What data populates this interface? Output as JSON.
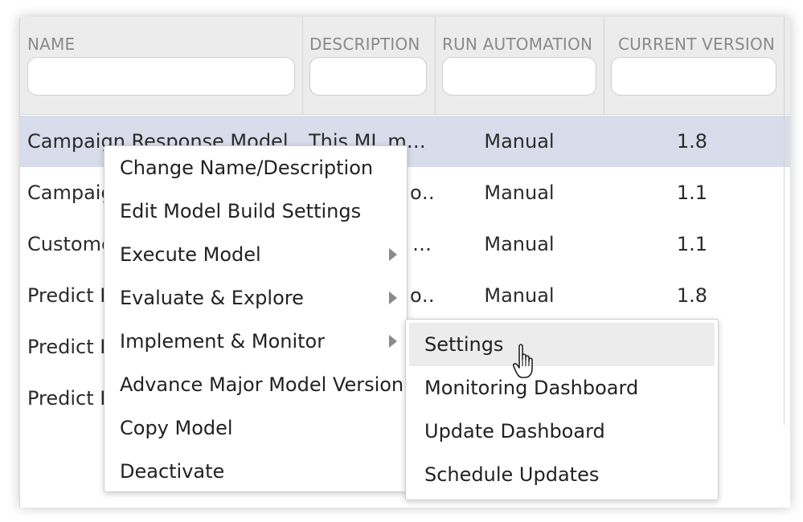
{
  "table": {
    "columns": [
      {
        "label": "NAME",
        "placeholder": ""
      },
      {
        "label": "DESCRIPTION",
        "placeholder": ""
      },
      {
        "label": "RUN AUTOMATION",
        "placeholder": ""
      },
      {
        "label": "CURRENT VERSION",
        "placeholder": ""
      }
    ],
    "rows": [
      {
        "name": "Campaign Response Model",
        "description": "This ML mo…",
        "run": "Manual",
        "version": "1.8"
      },
      {
        "name": "Campaign",
        "description": "o…",
        "run": "Manual",
        "version": "1.1"
      },
      {
        "name": "Custome",
        "description": "…",
        "run": "Manual",
        "version": "1.1"
      },
      {
        "name": "Predict F",
        "description": "o…",
        "run": "Manual",
        "version": "1.8"
      },
      {
        "name": "Predict F",
        "description": "",
        "run": "",
        "version": ""
      },
      {
        "name": "Predict F",
        "description": "",
        "run": "",
        "version": ""
      }
    ]
  },
  "context_menu": {
    "items": [
      {
        "label": "Change Name/Description",
        "has_submenu": false
      },
      {
        "label": "Edit Model Build Settings",
        "has_submenu": false
      },
      {
        "label": "Execute Model",
        "has_submenu": true
      },
      {
        "label": "Evaluate & Explore",
        "has_submenu": true
      },
      {
        "label": "Implement & Monitor",
        "has_submenu": true
      },
      {
        "label": "Advance Major Model Version",
        "has_submenu": false
      },
      {
        "label": "Copy Model",
        "has_submenu": false
      },
      {
        "label": "Deactivate",
        "has_submenu": false
      }
    ]
  },
  "submenu": {
    "items": [
      {
        "label": "Settings",
        "hovered": true
      },
      {
        "label": "Monitoring Dashboard",
        "hovered": false
      },
      {
        "label": "Update Dashboard",
        "hovered": false
      },
      {
        "label": "Schedule Updates",
        "hovered": false
      }
    ]
  },
  "colors": {
    "selected_row": "#d9dcea",
    "header_bg": "#ececec",
    "hover_item": "#ececec"
  }
}
